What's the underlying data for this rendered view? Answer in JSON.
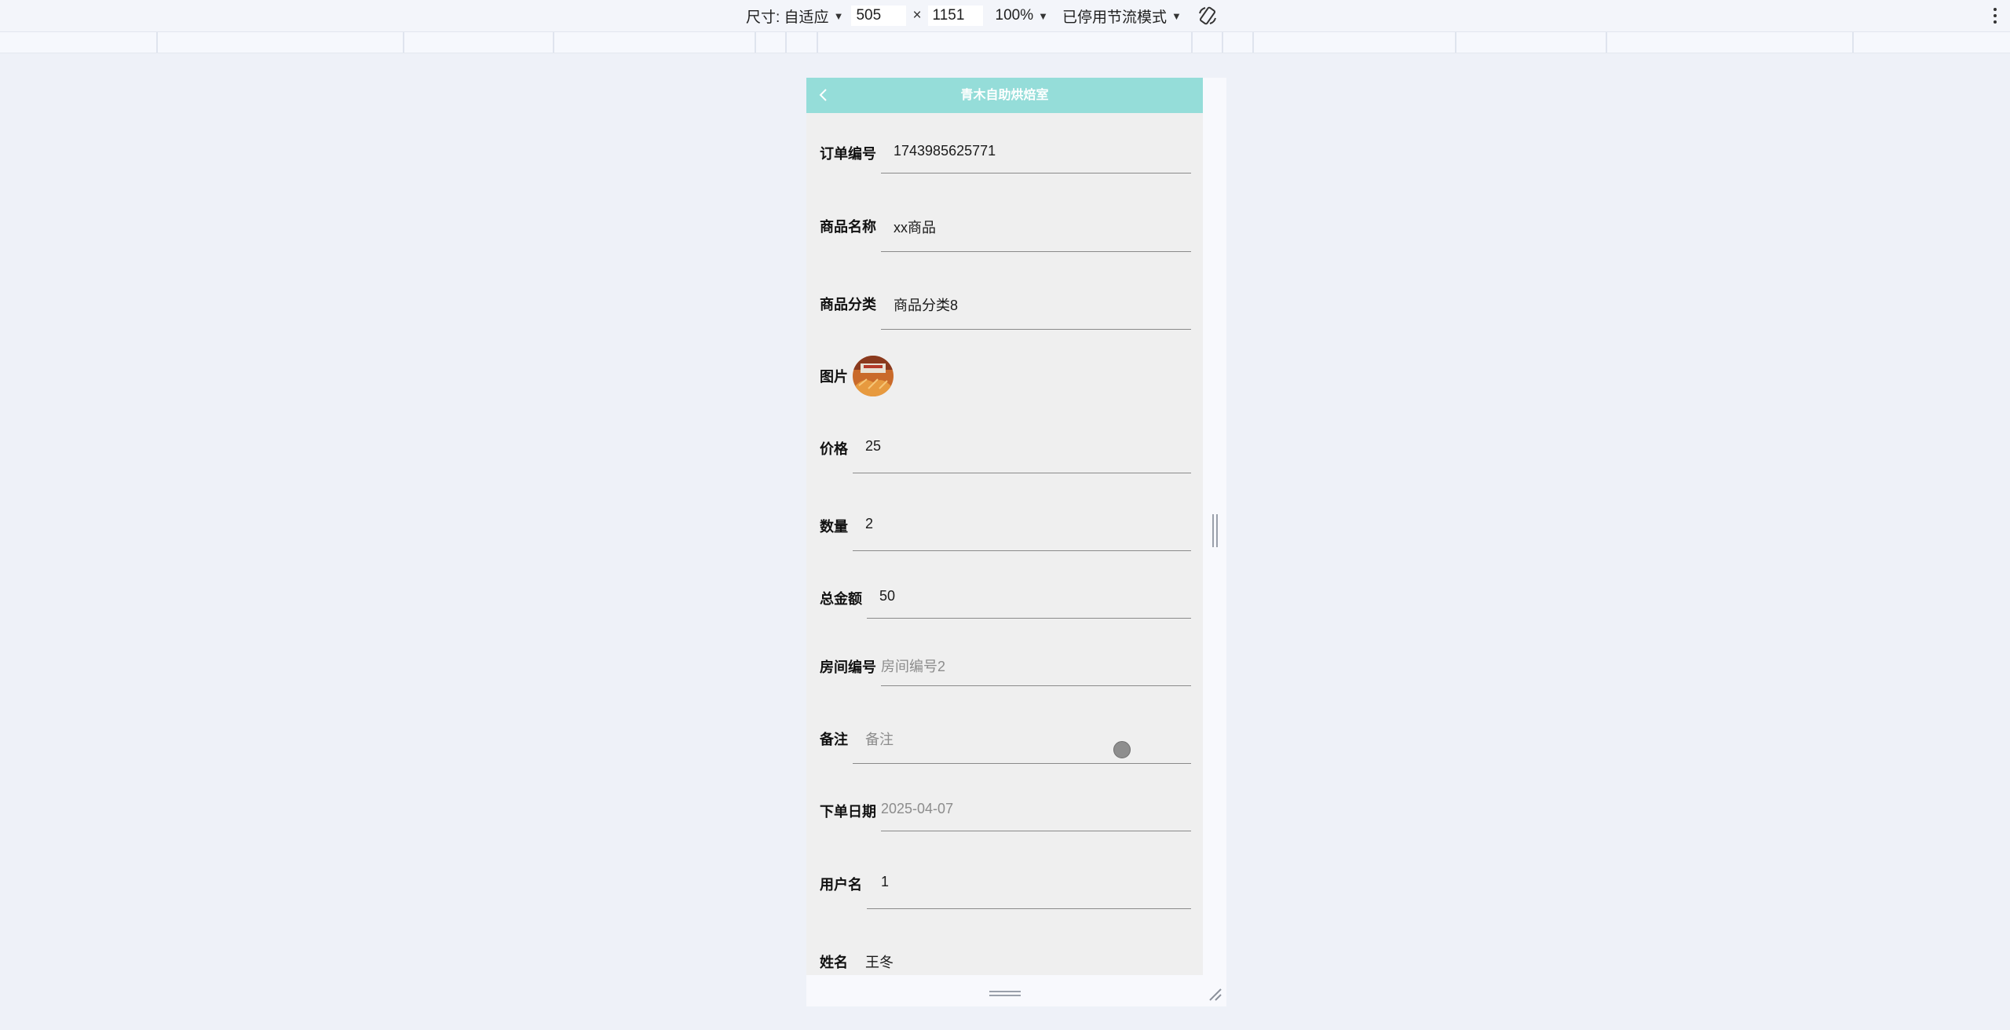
{
  "toolbar": {
    "dimensions_label": "尺寸: 自适应",
    "width_value": "505",
    "times": "×",
    "height_value": "1151",
    "zoom": "100%",
    "throttle": "已停用节流模式",
    "rotate_icon": "rotate-icon",
    "more_icon": "more-vert-icon"
  },
  "app": {
    "title": "青木自助烘焙室",
    "header_color": "#95ddd9",
    "back_icon": "chevron-left-icon"
  },
  "form": {
    "order_no": {
      "label": "订单编号",
      "value": "1743985625771"
    },
    "product_name": {
      "label": "商品名称",
      "value": "xx商品"
    },
    "product_category": {
      "label": "商品分类",
      "value": "商品分类8"
    },
    "image": {
      "label": "图片"
    },
    "price": {
      "label": "价格",
      "value": "25"
    },
    "quantity": {
      "label": "数量",
      "value": "2"
    },
    "total": {
      "label": "总金额",
      "value": "50"
    },
    "room_no": {
      "label": "房间编号",
      "placeholder": "房间编号2"
    },
    "remark": {
      "label": "备注",
      "placeholder": "备注"
    },
    "order_date": {
      "label": "下单日期",
      "placeholder": "2025-04-07"
    },
    "username": {
      "label": "用户名",
      "value": "1"
    },
    "name": {
      "label": "姓名",
      "value": "王冬"
    }
  }
}
